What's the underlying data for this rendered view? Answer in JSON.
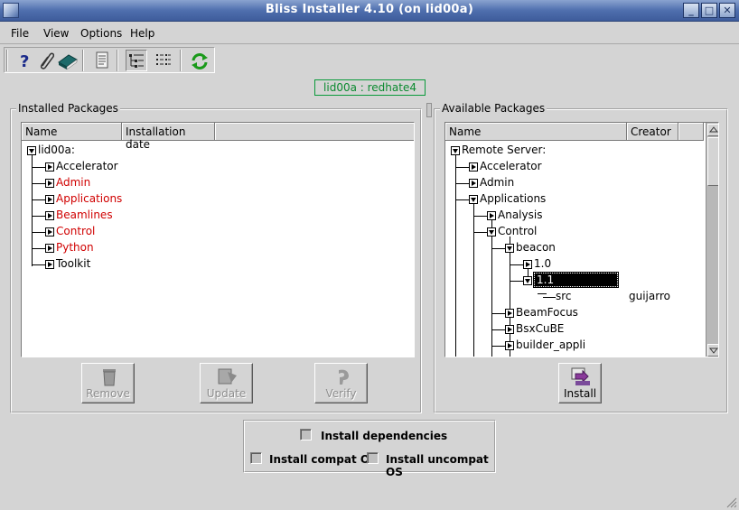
{
  "window": {
    "title": "Bliss Installer 4.10 (on lid00a)"
  },
  "menu": {
    "file": "File",
    "view": "View",
    "options": "Options",
    "help": "Help"
  },
  "toolbar": {
    "icons": [
      "help-icon",
      "paperclip-icon",
      "book-icon",
      "document-icon",
      "tree-view-icon",
      "list-view-icon",
      "refresh-icon"
    ]
  },
  "host_label": "lid00a : redhate4",
  "installed": {
    "title": "Installed Packages",
    "columns": [
      "Name",
      "Installation date"
    ],
    "root": "lid00a:",
    "items": [
      {
        "label": "Accelerator",
        "color": "#000000"
      },
      {
        "label": "Admin",
        "color": "#d00000"
      },
      {
        "label": "Applications",
        "color": "#d00000"
      },
      {
        "label": "Beamlines",
        "color": "#d00000"
      },
      {
        "label": "Control",
        "color": "#d00000"
      },
      {
        "label": "Python",
        "color": "#d00000"
      },
      {
        "label": "Toolkit",
        "color": "#000000"
      }
    ],
    "buttons": {
      "remove": "Remove",
      "update": "Update",
      "verify": "Verify"
    }
  },
  "available": {
    "title": "Available Packages",
    "columns": [
      "Name",
      "Creator"
    ],
    "tree": {
      "root": "Remote Server:",
      "accelerator": "Accelerator",
      "admin": "Admin",
      "applications": "Applications",
      "analysis": "Analysis",
      "control": "Control",
      "beacon": "beacon",
      "v10": "1.0",
      "v11": "1.1",
      "src": "src",
      "src_creator": "guijarro",
      "beamfocus": "BeamFocus",
      "bsxcube": "BsxCuBE",
      "builder": "builder_appli"
    },
    "buttons": {
      "install": "Install"
    }
  },
  "options": {
    "install_dependencies": "Install dependencies",
    "install_compat_os": "Install compat OS",
    "install_uncompat_os": "Install uncompat OS"
  }
}
